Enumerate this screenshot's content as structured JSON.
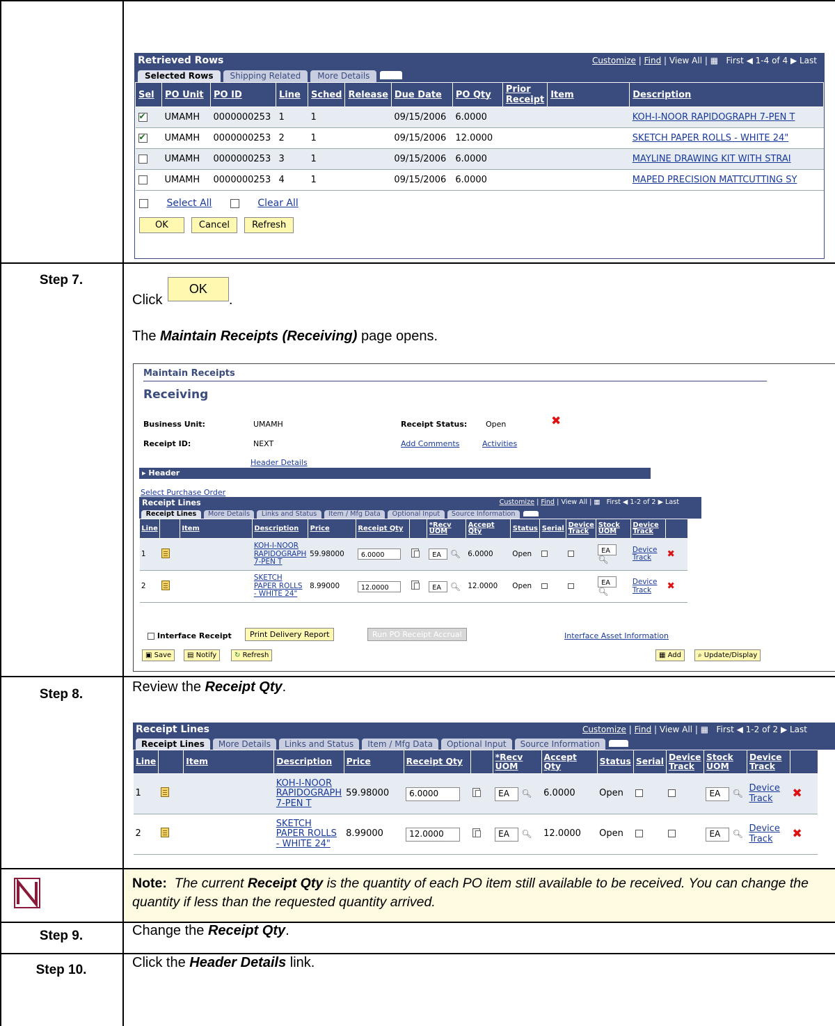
{
  "steps": {
    "s7": {
      "label": "Step 7.",
      "click_prefix": "Click",
      "click_suffix": ".",
      "ok_button": "OK",
      "page_opens_pre": "The ",
      "page_opens_em": "Maintain Receipts (Receiving)",
      "page_opens_post": " page opens."
    },
    "s8": {
      "label": "Step 8.",
      "pre": "Review the ",
      "em": "Receipt Qty",
      "post": "."
    },
    "note": {
      "label_bold": "Note:",
      "pre": "The current ",
      "em": "Receipt Qty",
      "post": " is the quantity of each PO item still available to be received.  You can change the quantity if less than the requested quantity arrived."
    },
    "s9": {
      "label": "Step 9.",
      "pre": "Change the ",
      "em": "Receipt Qty",
      "post": "."
    },
    "s10": {
      "label": "Step 10.",
      "pre": "Click the ",
      "em": "Header Details",
      "post": " link."
    }
  },
  "retrieved": {
    "title": "Retrieved Rows",
    "nav": {
      "customize": "Customize",
      "find": "Find",
      "view_all": "View All",
      "first": "First",
      "range": "1-4 of 4",
      "last": "Last"
    },
    "tabs": [
      "Selected Rows",
      "Shipping Related",
      "More Details"
    ],
    "columns": [
      "Sel",
      "PO Unit",
      "PO ID",
      "Line",
      "Sched",
      "Release",
      "Due Date",
      "PO Qty",
      "Prior Receipt",
      "Item",
      "Description"
    ],
    "rows": [
      {
        "sel": true,
        "unit": "UMAMH",
        "poid": "0000000253",
        "line": "1",
        "sched": "1",
        "release": "",
        "due": "09/15/2006",
        "qty": "6.0000",
        "prior": "",
        "item": "",
        "desc": "KOH-I-NOOR RAPIDOGRAPH 7-PEN T"
      },
      {
        "sel": true,
        "unit": "UMAMH",
        "poid": "0000000253",
        "line": "2",
        "sched": "1",
        "release": "",
        "due": "09/15/2006",
        "qty": "12.0000",
        "prior": "",
        "item": "",
        "desc": "SKETCH PAPER ROLLS - WHITE 24\""
      },
      {
        "sel": false,
        "unit": "UMAMH",
        "poid": "0000000253",
        "line": "3",
        "sched": "1",
        "release": "",
        "due": "09/15/2006",
        "qty": "6.0000",
        "prior": "",
        "item": "",
        "desc": "MAYLINE DRAWING KIT WITH STRAI"
      },
      {
        "sel": false,
        "unit": "UMAMH",
        "poid": "0000000253",
        "line": "4",
        "sched": "1",
        "release": "",
        "due": "09/15/2006",
        "qty": "6.0000",
        "prior": "",
        "item": "",
        "desc": "MAPED PRECISION MATTCUTTING SY"
      }
    ],
    "select_all": "Select All",
    "clear_all": "Clear All",
    "buttons": {
      "ok": "OK",
      "cancel": "Cancel",
      "refresh": "Refresh"
    }
  },
  "maintain": {
    "breadcrumb": "Maintain Receipts",
    "title": "Receiving",
    "business_unit_label": "Business Unit:",
    "business_unit": "UMAMH",
    "receipt_status_label": "Receipt Status:",
    "receipt_status": "Open",
    "receipt_id_label": "Receipt ID:",
    "receipt_id": "NEXT",
    "add_comments": "Add Comments",
    "activities": "Activities",
    "header_details": "Header Details",
    "header": "Header",
    "select_po": "Select Purchase Order",
    "interface_receipt": "Interface Receipt",
    "print_delivery": "Print Delivery Report",
    "run_accrual": "Run PO Receipt Accrual",
    "interface_asset": "Interface Asset Information",
    "save": "Save",
    "notify": "Notify",
    "refresh": "Refresh",
    "add": "Add",
    "update_display": "Update/Display"
  },
  "receipt_lines": {
    "title": "Receipt Lines",
    "nav": {
      "customize": "Customize",
      "find": "Find",
      "view_all": "View All",
      "first": "First",
      "range": "1-2 of 2",
      "last": "Last"
    },
    "tabs": [
      "Receipt Lines",
      "More Details",
      "Links and Status",
      "Item / Mfg Data",
      "Optional Input",
      "Source Information"
    ],
    "columns": [
      "Line",
      "",
      "Item",
      "Description",
      "Price",
      "Receipt Qty",
      "",
      "*Recv UOM",
      "Accept Qty",
      "Status",
      "Serial",
      "Device Track",
      "Stock UOM",
      "Device Track",
      ""
    ],
    "rows": [
      {
        "line": "1",
        "item": "",
        "desc": "KOH-I-NOOR RAPIDOGRAPH 7-PEN T",
        "price": "59.98000",
        "qty": "6.0000",
        "uom": "EA",
        "accept": "6.0000",
        "status": "Open",
        "stock_uom": "EA",
        "device": "Device Track"
      },
      {
        "line": "2",
        "item": "",
        "desc": "SKETCH PAPER ROLLS - WHITE 24\"",
        "price": "8.99000",
        "qty": "12.0000",
        "uom": "EA",
        "accept": "12.0000",
        "status": "Open",
        "stock_uom": "EA",
        "device": "Device Track"
      }
    ]
  }
}
